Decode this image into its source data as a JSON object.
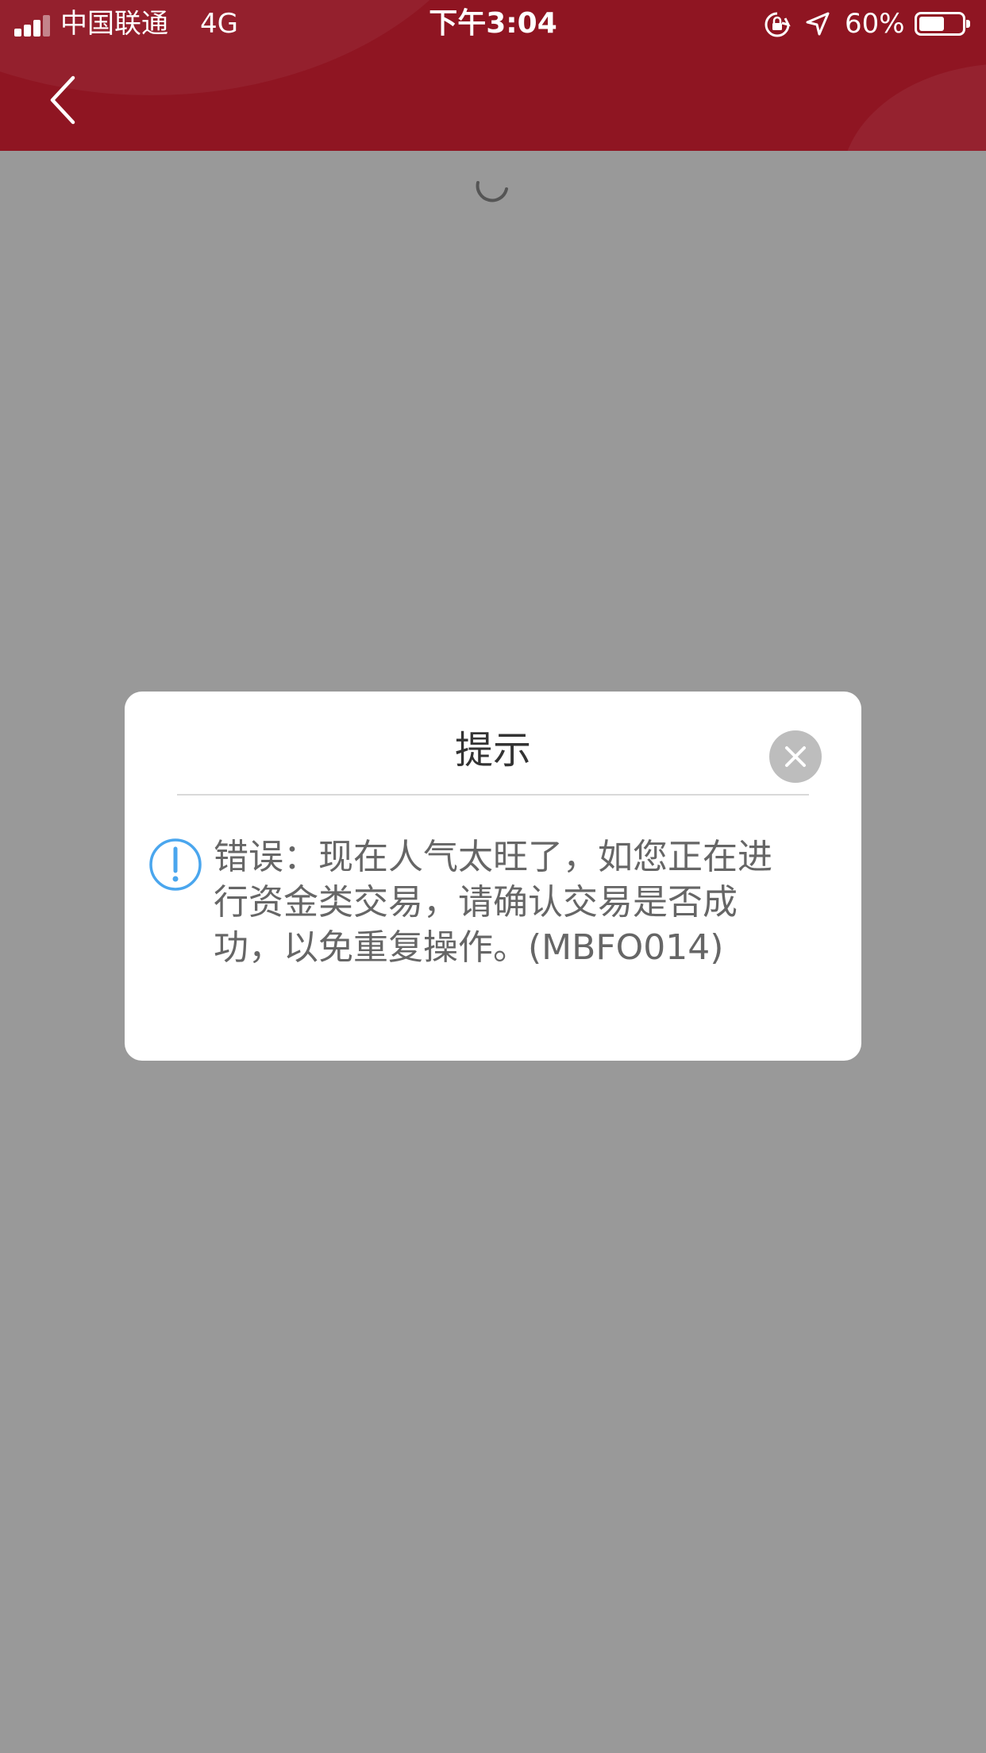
{
  "status_bar": {
    "carrier": "中国联通",
    "network": "4G",
    "time": "下午3:04",
    "battery_percent": "60%",
    "battery_level": 0.6
  },
  "header": {
    "background_color": "#8f1522",
    "back_icon": "chevron-left-icon"
  },
  "page": {
    "background_color": "#999999",
    "loading_icon": "spinner-icon"
  },
  "dialog": {
    "title": "提示",
    "close_icon": "close-icon",
    "alert_icon": "exclamation-circle-icon",
    "message": "错误：现在人气太旺了，如您正在进行资金类交易，请确认交易是否成功，以免重复操作。(MBFO014)"
  }
}
